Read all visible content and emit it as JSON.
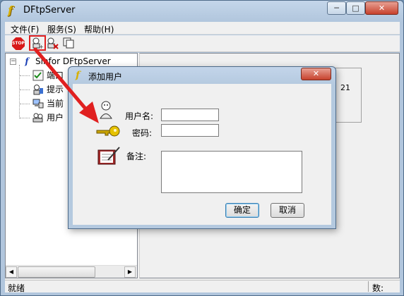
{
  "window": {
    "title": "DFtpServer",
    "app_icon": "f-logo-icon",
    "controls": {
      "minimize": "─",
      "maximize": "□",
      "close": "✕"
    }
  },
  "menu": {
    "items": [
      {
        "label": "文件(F)"
      },
      {
        "label": "服务(S)"
      },
      {
        "label": "帮助(H)"
      }
    ]
  },
  "toolbar": {
    "stop_label": "STOP",
    "icons": [
      "stop-icon",
      "add-user-icon",
      "delete-user-icon",
      "copy-icon"
    ]
  },
  "tree": {
    "root": "Sinfor DFtpServer",
    "children": [
      {
        "label": "端口",
        "icon": "checklist-icon"
      },
      {
        "label": "提示",
        "icon": "user-info-icon"
      },
      {
        "label": "当前",
        "icon": "computer-icon"
      },
      {
        "label": "用户",
        "icon": "users-icon"
      }
    ]
  },
  "right_panel": {
    "partial_text": "21"
  },
  "statusbar": {
    "ready": "就绪",
    "count_label": "数:"
  },
  "dialog": {
    "title": "添加用户",
    "username_label": "用户名:",
    "password_label": "密码:",
    "remark_label": "备注:",
    "username_value": "",
    "password_value": "",
    "remark_value": "",
    "ok_label": "确定",
    "cancel_label": "取消",
    "close": "✕"
  },
  "annotation": {
    "color": "#e02020"
  }
}
